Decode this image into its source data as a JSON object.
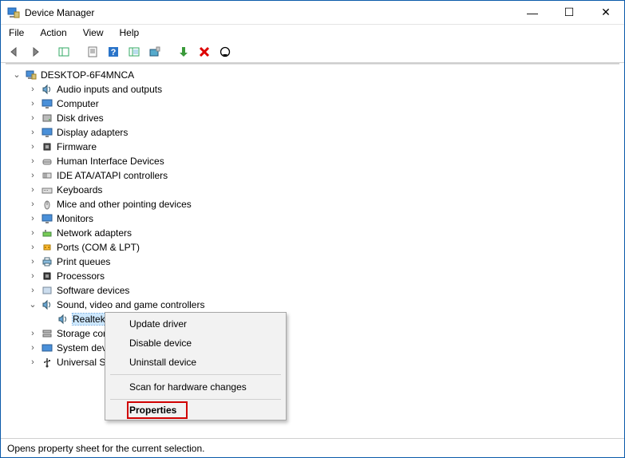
{
  "title": "Device Manager",
  "window_controls": {
    "min": "—",
    "max": "☐",
    "close": "✕"
  },
  "menu": [
    "File",
    "Action",
    "View",
    "Help"
  ],
  "tree": {
    "root": "DESKTOP-6F4MNCA",
    "items": [
      {
        "label": "Audio inputs and outputs",
        "icon": "speaker"
      },
      {
        "label": "Computer",
        "icon": "monitor"
      },
      {
        "label": "Disk drives",
        "icon": "disk"
      },
      {
        "label": "Display adapters",
        "icon": "monitor"
      },
      {
        "label": "Firmware",
        "icon": "chip"
      },
      {
        "label": "Human Interface Devices",
        "icon": "hid"
      },
      {
        "label": "IDE ATA/ATAPI controllers",
        "icon": "ide"
      },
      {
        "label": "Keyboards",
        "icon": "keyboard"
      },
      {
        "label": "Mice and other pointing devices",
        "icon": "mouse"
      },
      {
        "label": "Monitors",
        "icon": "monitor"
      },
      {
        "label": "Network adapters",
        "icon": "net"
      },
      {
        "label": "Ports (COM & LPT)",
        "icon": "port"
      },
      {
        "label": "Print queues",
        "icon": "printer"
      },
      {
        "label": "Processors",
        "icon": "cpu"
      },
      {
        "label": "Software devices",
        "icon": "soft"
      },
      {
        "label": "Sound, video and game controllers",
        "icon": "speaker",
        "expanded": true
      },
      {
        "label": "Storage cor",
        "icon": "storage"
      },
      {
        "label": "System dev",
        "icon": "sys"
      },
      {
        "label": "Universal Se",
        "icon": "usb"
      }
    ],
    "child_selected": "Realtek"
  },
  "context_menu": {
    "items": [
      "Update driver",
      "Disable device",
      "Uninstall device",
      "---",
      "Scan for hardware changes",
      "---",
      "Properties"
    ],
    "highlighted": "Properties"
  },
  "status": "Opens property sheet for the current selection."
}
